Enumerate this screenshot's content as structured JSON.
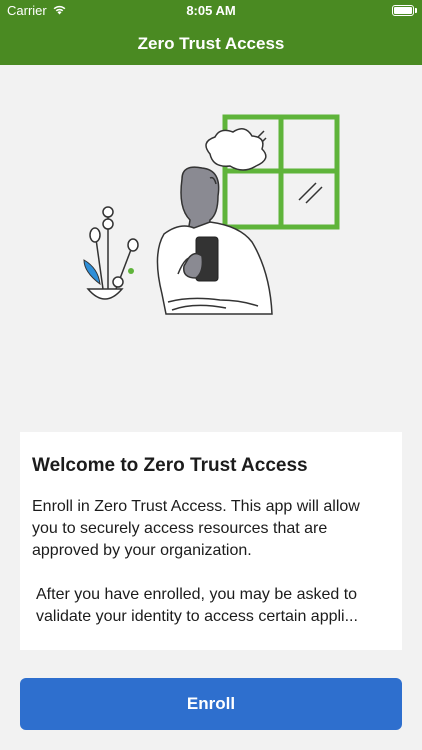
{
  "status": {
    "carrier": "Carrier",
    "time": "8:05 AM",
    "wifi_icon": "wifi-icon",
    "battery_icon": "battery-icon"
  },
  "navbar": {
    "title": "Zero Trust Access"
  },
  "colors": {
    "header_green": "#4a8a22",
    "illustration_green": "#5fb43a",
    "accent_blue": "#2e6fce",
    "card_bg": "#ffffff",
    "page_bg": "#f2f2f2"
  },
  "illustration": {
    "icon": "person-with-phone-illustration"
  },
  "welcome": {
    "title": "Welcome to Zero Trust Access",
    "paragraph1": "Enroll in Zero Trust Access. This app will allow you to securely access resources that are approved by your organization.",
    "paragraph2": "After you have enrolled, you may be asked to",
    "paragraph2_line2": "validate your identity to access certain appli..."
  },
  "actions": {
    "enroll_label": "Enroll"
  }
}
